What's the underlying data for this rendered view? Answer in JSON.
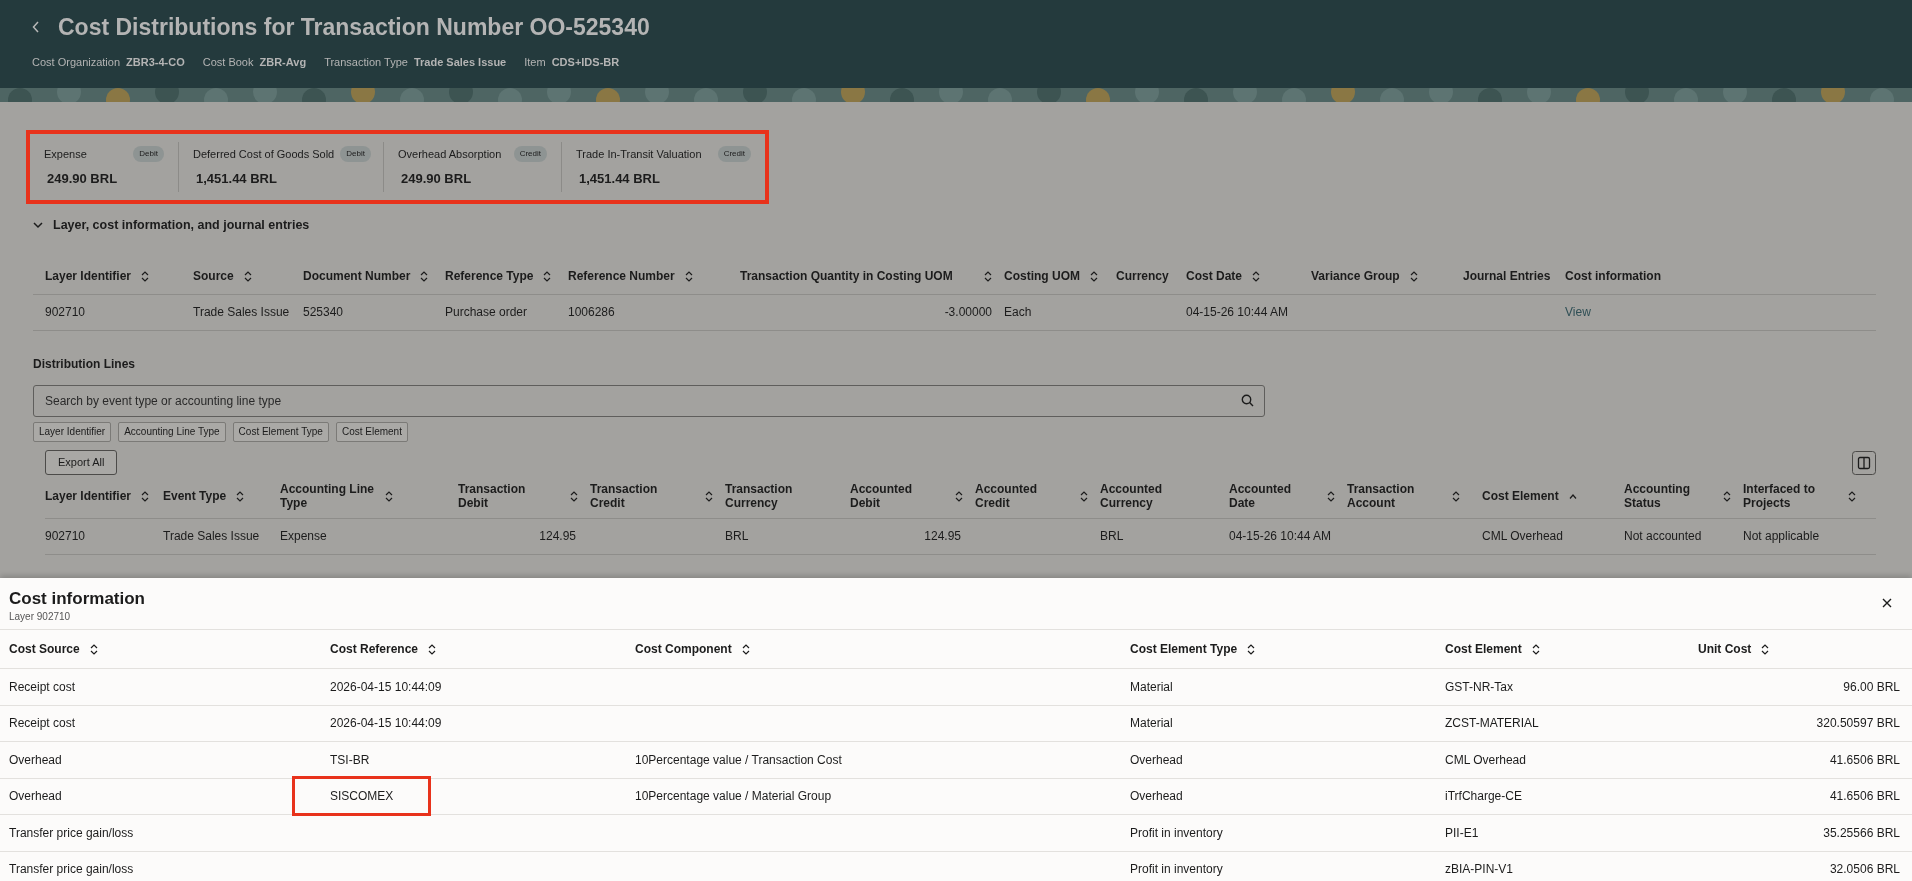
{
  "header": {
    "title": "Cost Distributions for Transaction Number OO-525340",
    "meta": [
      {
        "label": "Cost Organization",
        "value": "ZBR3-4-CO"
      },
      {
        "label": "Cost Book",
        "value": "ZBR-Avg"
      },
      {
        "label": "Transaction Type",
        "value": "Trade Sales Issue"
      },
      {
        "label": "Item",
        "value": "CDS+IDS-BR"
      }
    ]
  },
  "summary": {
    "highlighted": true,
    "items": [
      {
        "label": "Expense",
        "badge": "Debit",
        "amount": "249.90 BRL"
      },
      {
        "label": "Deferred Cost of Goods Sold",
        "badge": "Debit",
        "amount": "1,451.44 BRL"
      },
      {
        "label": "Overhead Absorption",
        "badge": "Credit",
        "amount": "249.90 BRL"
      },
      {
        "label": "Trade In-Transit Valuation",
        "badge": "Credit",
        "amount": "1,451.44 BRL"
      }
    ]
  },
  "section": {
    "title": "Layer, cost information, and journal entries",
    "expanded": true
  },
  "layer_table": {
    "columns": [
      {
        "label": "Layer Identifier",
        "sortable": true,
        "kind": "text"
      },
      {
        "label": "Source",
        "sortable": true,
        "kind": "text"
      },
      {
        "label": "Document Number",
        "sortable": true,
        "kind": "text"
      },
      {
        "label": "Reference Type",
        "sortable": true,
        "kind": "text"
      },
      {
        "label": "Reference Number",
        "sortable": true,
        "kind": "text"
      },
      {
        "label": "Transaction Quantity in Costing UOM",
        "sortable": true,
        "kind": "number"
      },
      {
        "label": "Costing UOM",
        "sortable": true,
        "kind": "text"
      },
      {
        "label": "Currency",
        "sortable": false,
        "kind": "text"
      },
      {
        "label": "Cost Date",
        "sortable": true,
        "kind": "text"
      },
      {
        "label": "Variance Group",
        "sortable": true,
        "kind": "text"
      },
      {
        "label": "Journal Entries",
        "sortable": false,
        "kind": "text"
      },
      {
        "label": "Cost information",
        "sortable": false,
        "kind": "link"
      }
    ],
    "rows": [
      [
        "902710",
        "Trade Sales Issue",
        "525340",
        "Purchase order",
        "1006286",
        "-3.00000",
        "Each",
        "",
        "04-15-26 10:44 AM",
        "",
        "",
        "View"
      ]
    ]
  },
  "distribution": {
    "title": "Distribution Lines",
    "search": {
      "placeholder": "Search by event type or accounting line type"
    },
    "filters": [
      "Layer Identifier",
      "Accounting Line Type",
      "Cost Element Type",
      "Cost Element"
    ],
    "export_button": "Export All",
    "columns": [
      {
        "label": "Layer Identifier",
        "sortable": true,
        "sorted_ascending": false,
        "kind": "text"
      },
      {
        "label": "Event Type",
        "sortable": true,
        "sorted_ascending": false,
        "kind": "text"
      },
      {
        "label": "Accounting Line Type",
        "sortable": true,
        "sorted_ascending": false,
        "kind": "text"
      },
      {
        "label": "Transaction Debit",
        "sortable": true,
        "sorted_ascending": false,
        "kind": "number"
      },
      {
        "label": "Transaction Credit",
        "sortable": true,
        "sorted_ascending": false,
        "kind": "number"
      },
      {
        "label": "Transaction Currency",
        "sortable": false,
        "kind": "text"
      },
      {
        "label": "Accounted Debit",
        "sortable": true,
        "sorted_ascending": false,
        "kind": "number"
      },
      {
        "label": "Accounted Credit",
        "sortable": true,
        "sorted_ascending": false,
        "kind": "number"
      },
      {
        "label": "Accounted Currency",
        "sortable": false,
        "kind": "text"
      },
      {
        "label": "Accounted Date",
        "sortable": true,
        "sorted_ascending": false,
        "kind": "text"
      },
      {
        "label": "Transaction Account",
        "sortable": true,
        "sorted_ascending": false,
        "kind": "text"
      },
      {
        "label": "Cost Element",
        "sortable": true,
        "sorted_ascending": true,
        "kind": "text"
      },
      {
        "label": "Accounting Status",
        "sortable": true,
        "sorted_ascending": false,
        "kind": "text"
      },
      {
        "label": "Interfaced to Projects",
        "sortable": true,
        "sorted_ascending": false,
        "kind": "text"
      }
    ],
    "rows": [
      [
        "902710",
        "Trade Sales Issue",
        "Expense",
        "124.95",
        "",
        "BRL",
        "124.95",
        "",
        "BRL",
        "04-15-26 10:44 AM",
        "",
        "CML Overhead",
        "Not accounted",
        "Not applicable"
      ]
    ]
  },
  "cost_panel": {
    "title": "Cost information",
    "subtitle": "Layer 902710",
    "columns": [
      {
        "label": "Cost Source",
        "sortable": true,
        "kind": "text"
      },
      {
        "label": "Cost Reference",
        "sortable": true,
        "kind": "text"
      },
      {
        "label": "Cost Component",
        "sortable": true,
        "kind": "text"
      },
      {
        "label": "Cost Element Type",
        "sortable": true,
        "kind": "text"
      },
      {
        "label": "Cost Element",
        "sortable": true,
        "kind": "text"
      },
      {
        "label": "Unit Cost",
        "sortable": true,
        "kind": "number"
      }
    ],
    "rows": [
      [
        "Receipt cost",
        "2026-04-15 10:44:09",
        "",
        "Material",
        "GST-NR-Tax",
        "96.00 BRL"
      ],
      [
        "Receipt cost",
        "2026-04-15 10:44:09",
        "",
        "Material",
        "ZCST-MATERIAL",
        "320.50597 BRL"
      ],
      [
        "Overhead",
        "TSI-BR",
        "10Percentage value / Transaction Cost",
        "Overhead",
        "CML Overhead",
        "41.6506 BRL"
      ],
      [
        "Overhead",
        {
          "text": "SISCOMEX",
          "highlighted": true
        },
        "10Percentage value / Material Group",
        "Overhead",
        "iTrfCharge-CE",
        "41.6506 BRL"
      ],
      [
        "Transfer price gain/loss",
        "",
        "",
        "Profit in inventory",
        "PII-E1",
        "35.25566 BRL"
      ],
      [
        "Transfer price gain/loss",
        "",
        "",
        "Profit in inventory",
        "zBIA-PIN-V1",
        "32.0506 BRL"
      ]
    ]
  }
}
